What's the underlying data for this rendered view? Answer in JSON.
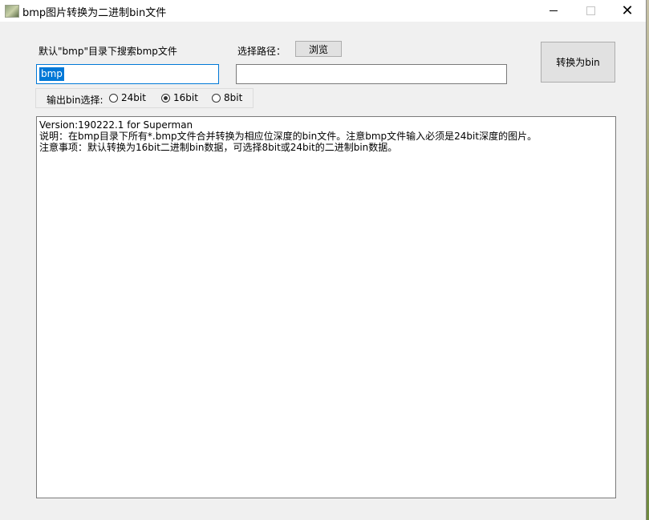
{
  "window": {
    "title": "bmp图片转换为二进制bin文件",
    "close_glyph": "✕"
  },
  "form": {
    "default_dir_label": "默认\"bmp\"目录下搜索bmp文件",
    "dir_value": "bmp",
    "path_label": "选择路径：",
    "browse_label": "浏览",
    "path_value": "",
    "convert_label": "转换为bin",
    "bit_group_label": "输出bin选择:",
    "options": [
      {
        "label": "24bit",
        "checked": false
      },
      {
        "label": "16bit",
        "checked": true
      },
      {
        "label": "8bit",
        "checked": false
      }
    ]
  },
  "output": {
    "lines": [
      "Version:190222.1 for Superman",
      "说明：在bmp目录下所有*.bmp文件合并转换为相应位深度的bin文件。注意bmp文件输入必须是24bit深度的图片。",
      "注意事项：默认转换为16bit二进制bin数据，可选择8bit或24bit的二进制bin数据。"
    ]
  }
}
